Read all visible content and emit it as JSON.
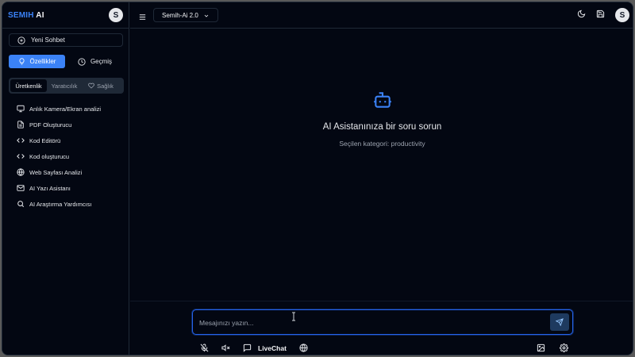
{
  "sidebar": {
    "brand_part1": "SEMIH",
    "brand_part2": " AI",
    "avatar_letter": "S",
    "new_chat_label": "Yeni Sohbet",
    "modes": {
      "features": "Özellikler",
      "history": "Geçmiş"
    },
    "categories": {
      "productivity": "Üretkenlik",
      "creativity": "Yaratıcılık",
      "health": "Sağlık"
    },
    "features": [
      {
        "label": "Anlık Kamera/Ekran analizi",
        "icon": "monitor-icon"
      },
      {
        "label": "PDF Oluşturucu",
        "icon": "file-text-icon"
      },
      {
        "label": "Kod Editörü",
        "icon": "code-icon"
      },
      {
        "label": "Kod oluşturucu",
        "icon": "code-icon"
      },
      {
        "label": "Web Sayfası Analizi",
        "icon": "globe-icon"
      },
      {
        "label": "AI Yazı Asistanı",
        "icon": "mail-icon"
      },
      {
        "label": "AI Araştırma Yardımcısı",
        "icon": "search-icon"
      }
    ]
  },
  "topbar": {
    "model_label": "Semih-Ai 2.0",
    "avatar_letter": "S"
  },
  "main": {
    "empty_title": "AI Asistanınıza bir soru sorun",
    "empty_subtitle": "Seçilen kategori: productivity"
  },
  "composer": {
    "placeholder": "Mesajınızı yazın...",
    "value": "",
    "livechat_label": "LiveChat"
  },
  "colors": {
    "background": "#030712",
    "accent": "#3b82f6",
    "border": "#1f2937"
  }
}
